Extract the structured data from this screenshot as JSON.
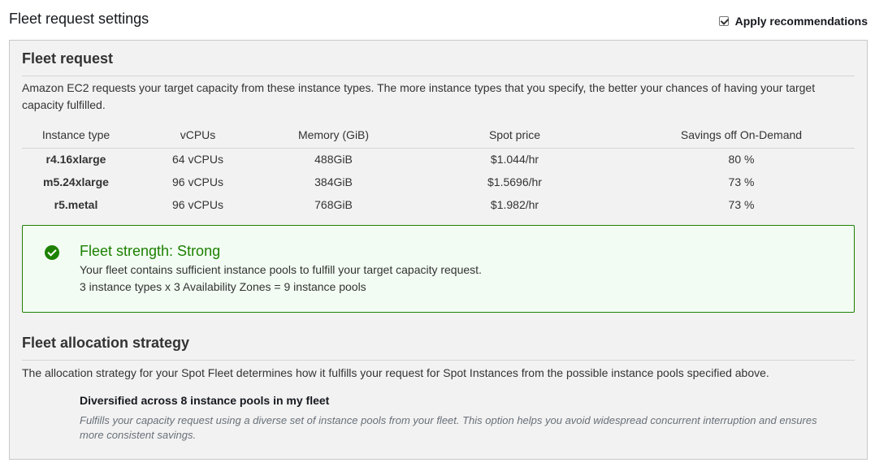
{
  "header": {
    "title": "Fleet request settings",
    "apply_recommendations_label": "Apply recommendations",
    "apply_recommendations_checked": true
  },
  "fleet_request": {
    "title": "Fleet request",
    "description": "Amazon EC2 requests your target capacity from these instance types. The more instance types that you specify, the better your chances of having your target capacity fulfilled.",
    "columns": [
      "Instance type",
      "vCPUs",
      "Memory (GiB)",
      "Spot price",
      "Savings off On-Demand"
    ],
    "rows": [
      [
        "r4.16xlarge",
        "64 vCPUs",
        "488GiB",
        "$1.044/hr",
        "80 %"
      ],
      [
        "m5.24xlarge",
        "96 vCPUs",
        "384GiB",
        "$1.5696/hr",
        "73 %"
      ],
      [
        "r5.metal",
        "96 vCPUs",
        "768GiB",
        "$1.982/hr",
        "73 %"
      ]
    ]
  },
  "fleet_strength": {
    "title": "Fleet strength: Strong",
    "line1": "Your fleet contains sufficient instance pools to fulfill your target capacity request.",
    "line2": "3 instance types x 3 Availability Zones = 9 instance pools",
    "status_color": "#1d8102"
  },
  "allocation_strategy": {
    "title": "Fleet allocation strategy",
    "description": "The allocation strategy for your Spot Fleet determines how it fulfills your request for Spot Instances from the possible instance pools specified above.",
    "strategy_name": "Diversified across 8 instance pools in my fleet",
    "strategy_description": "Fulfills your capacity request using a diverse set of instance pools from your fleet. This option helps you avoid widespread concurrent interruption and ensures more consistent savings."
  }
}
